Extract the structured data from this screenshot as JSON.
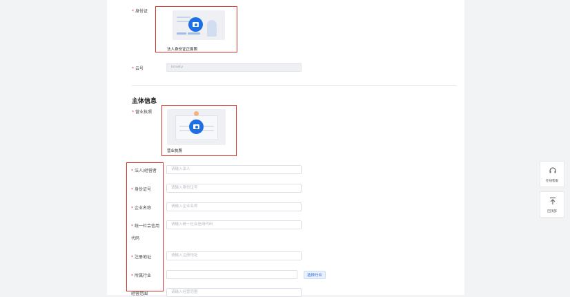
{
  "id_card": {
    "label": "身份证",
    "caption": "法人身份证正面照"
  },
  "account": {
    "label": "云号",
    "value": "kmaty"
  },
  "section": {
    "title": "主体信息"
  },
  "license": {
    "label": "营业执照",
    "caption": "营业执照"
  },
  "fields": {
    "legal_person": {
      "label": "法人/经营者",
      "placeholder": "请输入法人"
    },
    "id_number": {
      "label": "身份证号",
      "placeholder": "请输入身份证号"
    },
    "company_name": {
      "label": "企业名称",
      "placeholder": "请输入企业名称"
    },
    "credit_code": {
      "label_line1": "统一社会信用",
      "label_line2": "代码",
      "placeholder": "请输入统一社会信用代码"
    },
    "reg_address": {
      "label": "注册地址",
      "placeholder": "请输入注册地址"
    },
    "industry": {
      "label": "所属行业",
      "button": "选择行业"
    },
    "business_scope": {
      "label": "经营范围",
      "placeholder": "请输入经营范围"
    }
  },
  "float": {
    "service": "在线客服",
    "top": "回顶部"
  },
  "colors": {
    "accent": "#1e6fe3",
    "highlight_border": "#d9342b",
    "required": "#e04a3c"
  }
}
